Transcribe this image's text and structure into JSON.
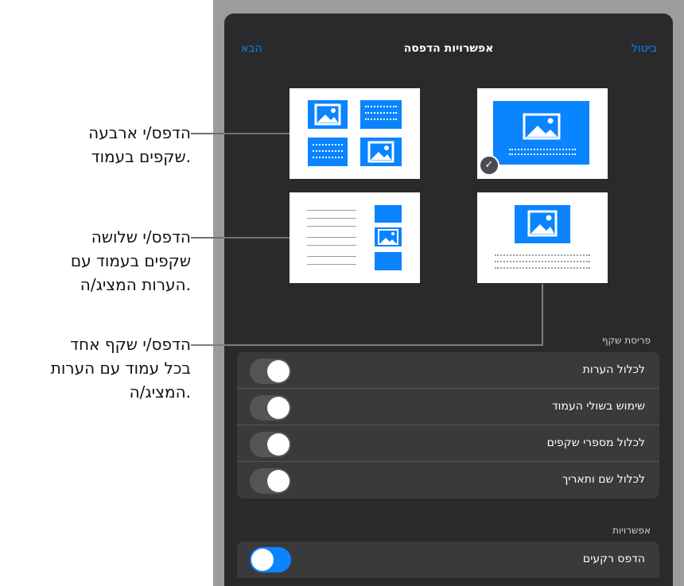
{
  "header": {
    "title": "אפשרויות הדפסה",
    "cancel_label": "ביטול",
    "next_label": "הבא"
  },
  "callouts": {
    "four_per_page_line1": "הדפס/י ארבעה",
    "four_per_page_line2": "שקפים בעמוד.",
    "three_with_notes_line1": "הדפס/י שלושה",
    "three_with_notes_line2": "שקפים בעמוד עם",
    "three_with_notes_line3": "הערות המציג/ה.",
    "one_with_notes_line1": "הדפס/י שקף אחד",
    "one_with_notes_line2": "בכל עמוד עם הערות",
    "one_with_notes_line3": "המציג/ה."
  },
  "layout_section": {
    "label": "פריסת שקף",
    "rows": [
      {
        "label": "לכלול הערות",
        "on": false
      },
      {
        "label": "שימוש בשולי העמוד",
        "on": false
      },
      {
        "label": "לכלול מספרי שקפים",
        "on": false
      },
      {
        "label": "לכלול שם ותאריך",
        "on": false
      }
    ]
  },
  "options_section": {
    "label": "אפשרויות",
    "rows": [
      {
        "label": "הדפס רקעים",
        "on": true
      }
    ]
  },
  "colors": {
    "accent": "#0a84ff",
    "panel": "#2a2a2c",
    "group": "#3a3a3c"
  }
}
